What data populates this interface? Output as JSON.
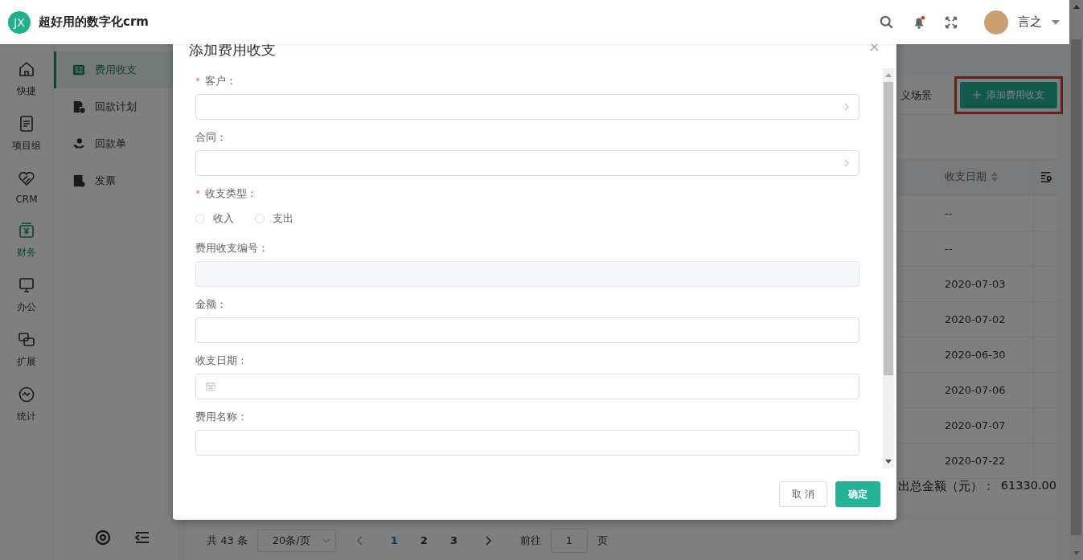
{
  "header": {
    "logo": "JX",
    "title": "超好用的数字化crm",
    "user": "言之"
  },
  "rail": [
    {
      "label": "快捷",
      "selected": false
    },
    {
      "label": "项目组",
      "selected": false
    },
    {
      "label": "CRM",
      "selected": false
    },
    {
      "label": "财务",
      "selected": true
    },
    {
      "label": "办公",
      "selected": false
    },
    {
      "label": "扩展",
      "selected": false
    },
    {
      "label": "统计",
      "selected": false
    }
  ],
  "subnav": [
    {
      "label": "费用收支",
      "selected": true
    },
    {
      "label": "回款计划",
      "selected": false
    },
    {
      "label": "回款单",
      "selected": false
    },
    {
      "label": "发票",
      "selected": false
    }
  ],
  "toolbar": {
    "scene": "义场景",
    "add_button": "添加费用收支",
    "highlighted": true
  },
  "table": {
    "columns": [
      "收支日期"
    ],
    "rows": [
      "--",
      "--",
      "2020-07-03",
      "2020-07-02",
      "2020-06-30",
      "2020-07-06",
      "2020-07-07",
      "2020-07-22"
    ]
  },
  "summary": {
    "label": "出总金额（元）：",
    "value": "61330.00"
  },
  "pagination": {
    "total": "共 43 条",
    "page_size": "20条/页",
    "pages": [
      {
        "label": "1",
        "selected": true
      },
      {
        "label": "2",
        "selected": false
      },
      {
        "label": "3",
        "selected": false
      }
    ],
    "goto": "前往",
    "goto_value": "1",
    "goto_unit": "页"
  },
  "dialog": {
    "title": "添加费用收支",
    "fields": [
      {
        "label": "客户：",
        "required": true,
        "kind": "select"
      },
      {
        "label": "合同：",
        "required": false,
        "kind": "select"
      },
      {
        "label": "收支类型：",
        "required": true,
        "kind": "radio",
        "options": [
          {
            "label": "收入",
            "selected": false
          },
          {
            "label": "支出",
            "selected": false
          }
        ]
      },
      {
        "label": "费用收支编号：",
        "required": false,
        "kind": "disabled"
      },
      {
        "label": "金额：",
        "required": false,
        "kind": "text"
      },
      {
        "label": "收支日期：",
        "required": false,
        "kind": "date"
      },
      {
        "label": "费用名称：",
        "required": false,
        "kind": "text"
      }
    ],
    "buttons": [
      {
        "label": "取 消",
        "kind": "secondary"
      },
      {
        "label": "确定",
        "kind": "primary"
      }
    ]
  }
}
